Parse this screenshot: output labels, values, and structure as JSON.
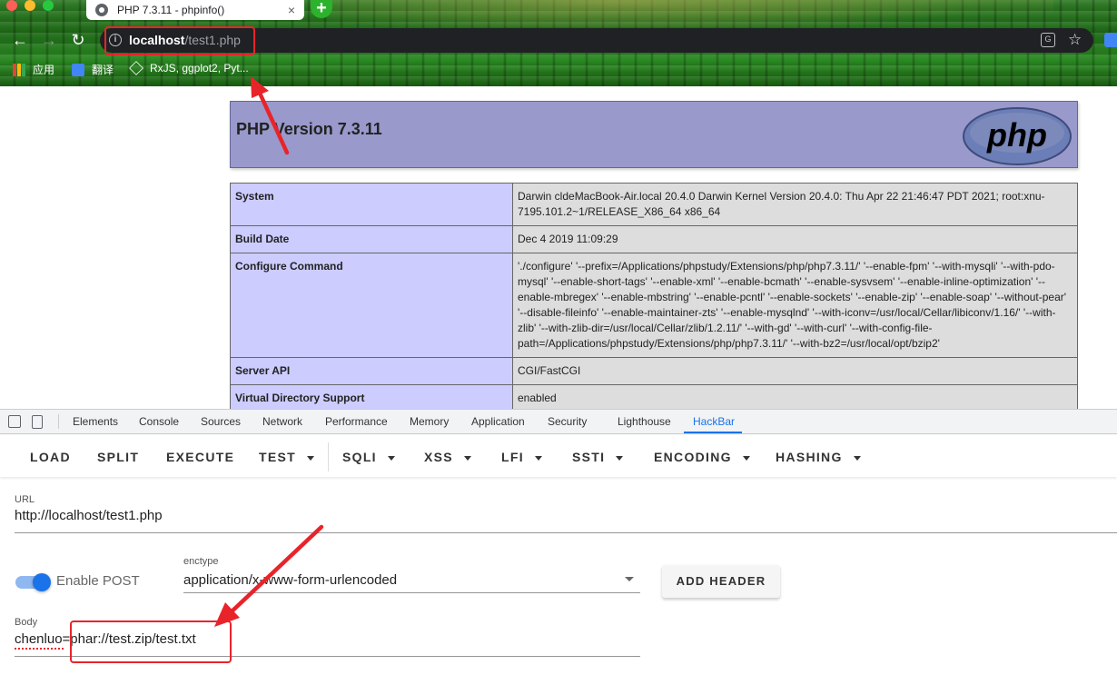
{
  "browser": {
    "tab_title": "PHP 7.3.11 - phpinfo()",
    "tab_close": "×",
    "new_tab": "+",
    "url_host": "localhost",
    "url_path": "/test1.php",
    "info_icon": "i",
    "translate_icon": "G",
    "star": "☆",
    "nav": {
      "back": "←",
      "forward": "→",
      "reload": "↻"
    },
    "bookmarks": [
      {
        "label": "应用",
        "icon": "apps-grid-icon"
      },
      {
        "label": "翻译",
        "icon": "google-translate-icon"
      },
      {
        "label": "RxJS, ggplot2, Pyt...",
        "icon": "bookmark-site-icon"
      }
    ]
  },
  "phpinfo": {
    "version_title": "PHP Version 7.3.11",
    "logo_text": "php",
    "rows": [
      {
        "key": "System",
        "value": "Darwin cldeMacBook-Air.local 20.4.0 Darwin Kernel Version 20.4.0: Thu Apr 22 21:46:47 PDT 2021; root:xnu-7195.101.2~1/RELEASE_X86_64 x86_64"
      },
      {
        "key": "Build Date",
        "value": "Dec 4 2019 11:09:29"
      },
      {
        "key": "Configure Command",
        "value": "'./configure' '--prefix=/Applications/phpstudy/Extensions/php/php7.3.11/' '--enable-fpm' '--with-mysqli' '--with-pdo-mysql' '--enable-short-tags' '--enable-xml' '--enable-bcmath' '--enable-sysvsem' '--enable-inline-optimization' '--enable-mbregex' '--enable-mbstring' '--enable-pcntl' '--enable-sockets' '--enable-zip' '--enable-soap' '--without-pear' '--disable-fileinfo' '--enable-maintainer-zts' '--enable-mysqlnd' '--with-iconv=/usr/local/Cellar/libiconv/1.16/' '--with-zlib' '--with-zlib-dir=/usr/local/Cellar/zlib/1.2.11/' '--with-gd' '--with-curl' '--with-config-file-path=/Applications/phpstudy/Extensions/php/php7.3.11/' '--with-bz2=/usr/local/opt/bzip2'"
      },
      {
        "key": "Server API",
        "value": "CGI/FastCGI"
      },
      {
        "key": "Virtual Directory Support",
        "value": "enabled"
      }
    ]
  },
  "devtools": {
    "tabs": [
      "Elements",
      "Console",
      "Sources",
      "Network",
      "Performance",
      "Memory",
      "Application",
      "Security",
      "Lighthouse",
      "HackBar"
    ],
    "active_tab": "HackBar"
  },
  "hackbar": {
    "buttons": [
      {
        "label": "LOAD",
        "dropdown": false
      },
      {
        "label": "SPLIT",
        "dropdown": false
      },
      {
        "label": "EXECUTE",
        "dropdown": false
      },
      {
        "label": "TEST",
        "dropdown": true
      },
      {
        "label": "SQLI",
        "dropdown": true
      },
      {
        "label": "XSS",
        "dropdown": true
      },
      {
        "label": "LFI",
        "dropdown": true
      },
      {
        "label": "SSTI",
        "dropdown": true
      },
      {
        "label": "ENCODING",
        "dropdown": true
      },
      {
        "label": "HASHING",
        "dropdown": true
      }
    ],
    "url_label": "URL",
    "url_value": "http://localhost/test1.php",
    "enable_post_label": "Enable POST",
    "enable_post": true,
    "enctype_label": "enctype",
    "enctype_value": "application/x-www-form-urlencoded",
    "add_header_label": "ADD HEADER",
    "body_label": "Body",
    "body_value": "chenluo=phar://test.zip/test.txt"
  },
  "colors": {
    "annotation_red": "#e8242a",
    "accent_blue": "#1a73e8",
    "php_header": "#9999cc",
    "php_key_cell": "#ccccff",
    "php_value_cell": "#dddddd"
  }
}
